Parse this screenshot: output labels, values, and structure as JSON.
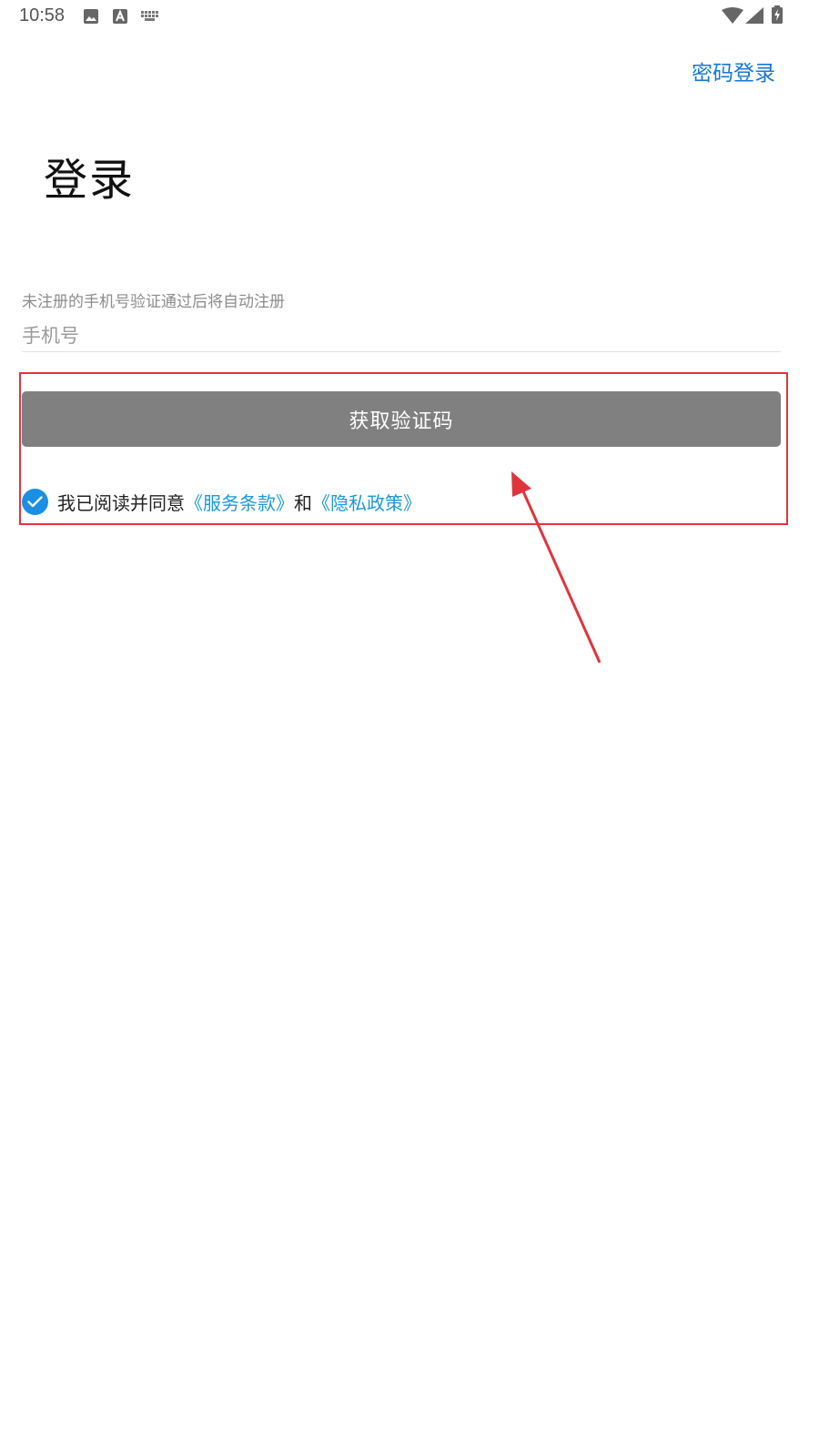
{
  "status_bar": {
    "time": "10:58",
    "left_icons": [
      "image-icon",
      "a-square-icon",
      "keyboard-icon"
    ],
    "right_icons": [
      "wifi-icon",
      "signal-icon",
      "battery-charging-icon"
    ]
  },
  "header": {
    "password_login_label": "密码登录"
  },
  "main": {
    "title": "登录",
    "hint": "未注册的手机号验证通过后将自动注册",
    "phone_placeholder": "手机号",
    "phone_value": "",
    "get_code_label": "获取验证码"
  },
  "agreement": {
    "checked": true,
    "prefix": "我已阅读并同意",
    "terms_link": "《服务条款》",
    "and": "和",
    "privacy_link": "《隐私政策》"
  },
  "colors": {
    "link_blue": "#1677d6",
    "agreement_link": "#1a9ad6",
    "button_gray": "#808080",
    "checkbox_blue": "#1a8fe3",
    "annotation_red": "#e0343c"
  }
}
